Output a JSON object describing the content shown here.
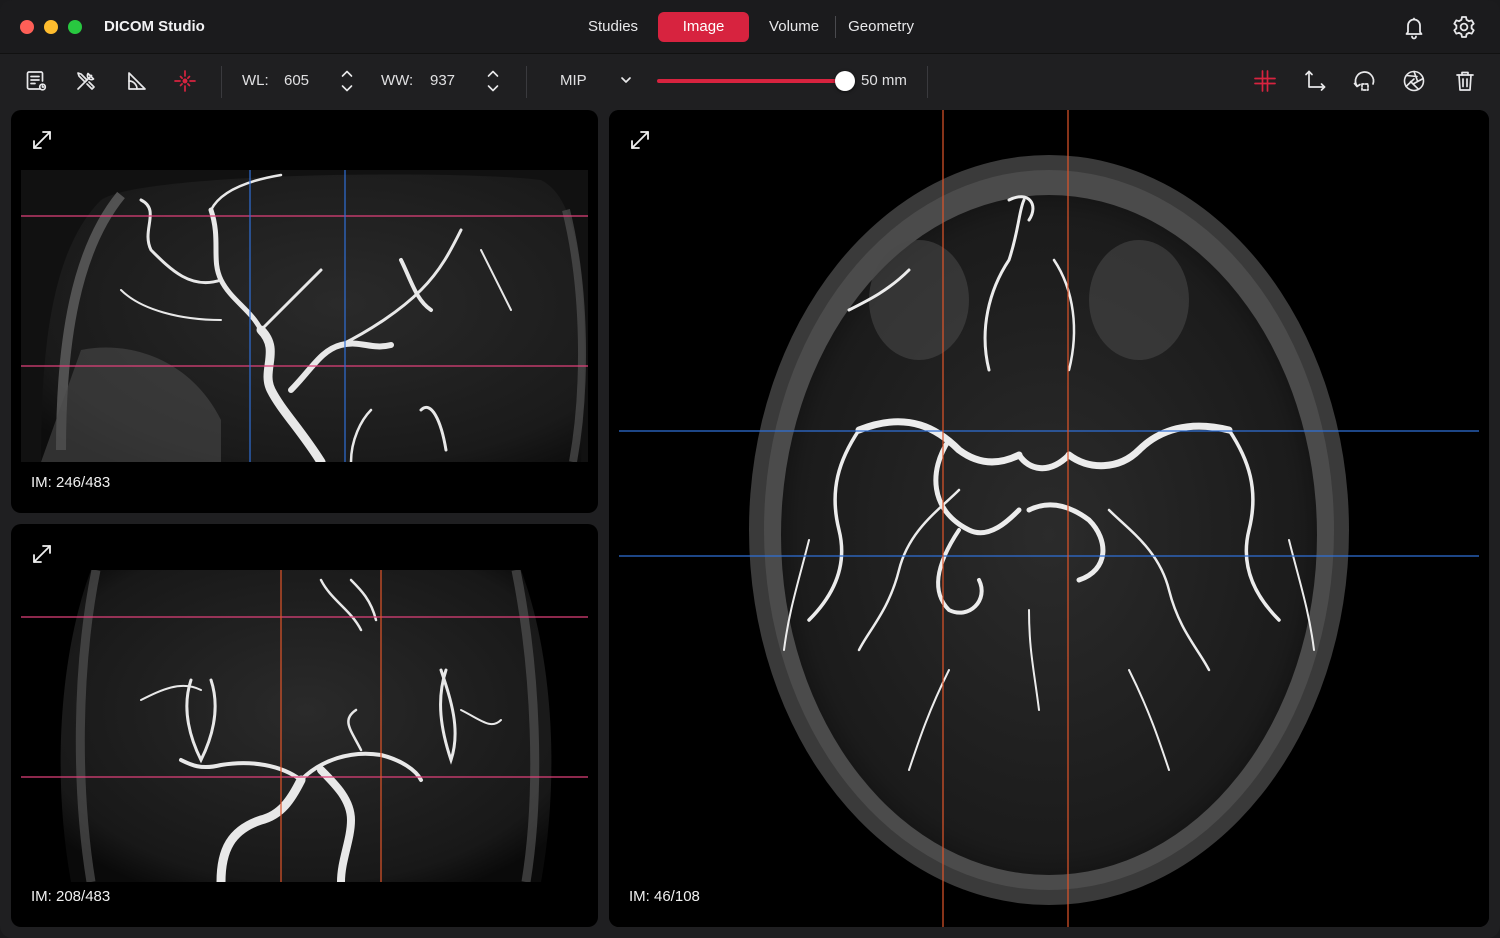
{
  "app": {
    "title": "DICOM Studio"
  },
  "nav": {
    "tabs": [
      {
        "label": "Studies",
        "active": false
      },
      {
        "label": "Image",
        "active": true
      },
      {
        "label": "Volume",
        "active": false
      },
      {
        "label": "Geometry",
        "active": false
      }
    ]
  },
  "titlebar_icons": [
    "bell-icon",
    "gear-icon"
  ],
  "toolbar": {
    "wl_label": "WL:",
    "wl_value": "605",
    "ww_label": "WW:",
    "ww_value": "937",
    "projection": "MIP",
    "slab_value": "50 mm",
    "slab_fraction": 0.95,
    "left_tools": [
      "report-icon",
      "tools-icon",
      "ruler-angle-icon",
      "crosshair-target-icon"
    ],
    "right_tools": [
      "crosshair-icon",
      "axis-icon",
      "rotate-icon",
      "aperture-icon",
      "trash-icon"
    ]
  },
  "viewports": {
    "sagittal": {
      "label": "IM: 246/483"
    },
    "coronal": {
      "label": "IM: 208/483"
    },
    "axial": {
      "label": "IM: 46/108"
    }
  },
  "colors": {
    "accent": "#d7233f",
    "crosshair_pink": "#e0407a",
    "crosshair_blue": "#2f6fd6",
    "crosshair_orange": "#e0552a"
  }
}
